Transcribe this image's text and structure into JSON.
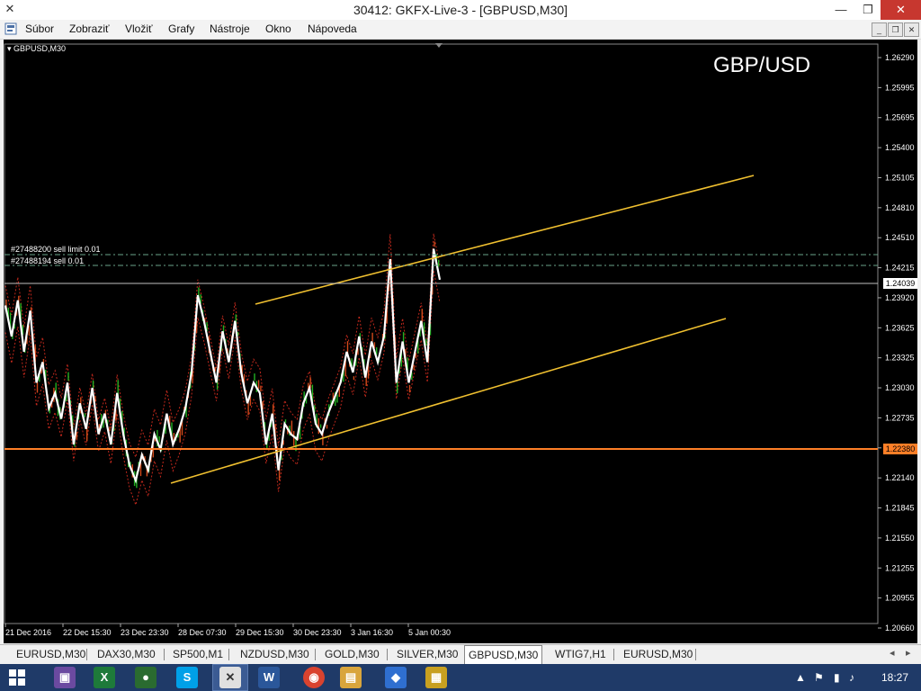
{
  "window": {
    "title": "30412: GKFX-Live-3 - [GBPUSD,M30]"
  },
  "menu": [
    {
      "label": "Súbor"
    },
    {
      "label": "Zobraziť"
    },
    {
      "label": "Vložiť"
    },
    {
      "label": "Grafy"
    },
    {
      "label": "Nástroje"
    },
    {
      "label": "Okno"
    },
    {
      "label": "Nápoveda"
    }
  ],
  "chart": {
    "symbol_label": "GBPUSD,M30",
    "big_label": "GBP/USD",
    "colors": {
      "background": "#000000",
      "price": "#ffffff",
      "bull": "#22b022",
      "bear": "#d24a1a",
      "channel": "#f0c030",
      "support": "#ff7f27",
      "band": "#c0281c",
      "order_line": "#6aa58a"
    },
    "orders": [
      {
        "label": "#27488200 sell limit 0.01",
        "price": 1.2432
      },
      {
        "label": "#27488194 sell 0.01",
        "price": 1.242
      }
    ],
    "current_price": "1.24039",
    "support_price": "1.22380"
  },
  "chart_data": {
    "type": "line",
    "title": "GBP/USD",
    "series": [
      {
        "values": [
          1.2375,
          1.2345,
          1.238,
          1.233,
          1.237,
          1.23,
          1.232,
          1.2275,
          1.229,
          1.2265,
          1.23,
          1.224,
          1.228,
          1.2255,
          1.2295,
          1.225,
          1.227,
          1.224,
          1.229,
          1.225,
          1.222,
          1.2205,
          1.223,
          1.2215,
          1.225,
          1.2235,
          1.227,
          1.224,
          1.2255,
          1.2275,
          1.231,
          1.2385,
          1.236,
          1.233,
          1.23,
          1.235,
          1.232,
          1.236,
          1.231,
          1.228,
          1.23,
          1.229,
          1.224,
          1.227,
          1.2215,
          1.226,
          1.225,
          1.2245,
          1.228,
          1.2295,
          1.226,
          1.225,
          1.227,
          1.2285,
          1.23,
          1.233,
          1.231,
          1.2345,
          1.2305,
          1.234,
          1.232,
          1.2345,
          1.242,
          1.23,
          1.234,
          1.23,
          1.233,
          1.236,
          1.232,
          1.243,
          1.24
        ]
      }
    ],
    "x_ticks": [
      "21 Dec 2016",
      "22 Dec 15:30",
      "23 Dec 23:30",
      "28 Dec 07:30",
      "29 Dec 15:30",
      "30 Dec 23:30",
      "3 Jan 16:30",
      "5 Jan 00:30"
    ],
    "y_ticks": [
      "1.26290",
      "1.25995",
      "1.25695",
      "1.25400",
      "1.25105",
      "1.24810",
      "1.24510",
      "1.24215",
      "1.23920",
      "1.23625",
      "1.23325",
      "1.23030",
      "1.22735",
      "1.22440",
      "1.22140",
      "1.21845",
      "1.21550",
      "1.21255",
      "1.20955",
      "1.20660"
    ],
    "ylim": [
      1.2066,
      1.2629
    ]
  },
  "tabs": [
    {
      "label": "EURUSD,M30"
    },
    {
      "label": "DAX30,M30"
    },
    {
      "label": "SP500,M1"
    },
    {
      "label": "NZDUSD,M30"
    },
    {
      "label": "GOLD,M30"
    },
    {
      "label": "SILVER,M30"
    },
    {
      "label": "GBPUSD,M30"
    },
    {
      "label": "WTIG7,H1"
    },
    {
      "label": "EURUSD,M30"
    }
  ],
  "taskbar": {
    "clock": "18:27"
  }
}
